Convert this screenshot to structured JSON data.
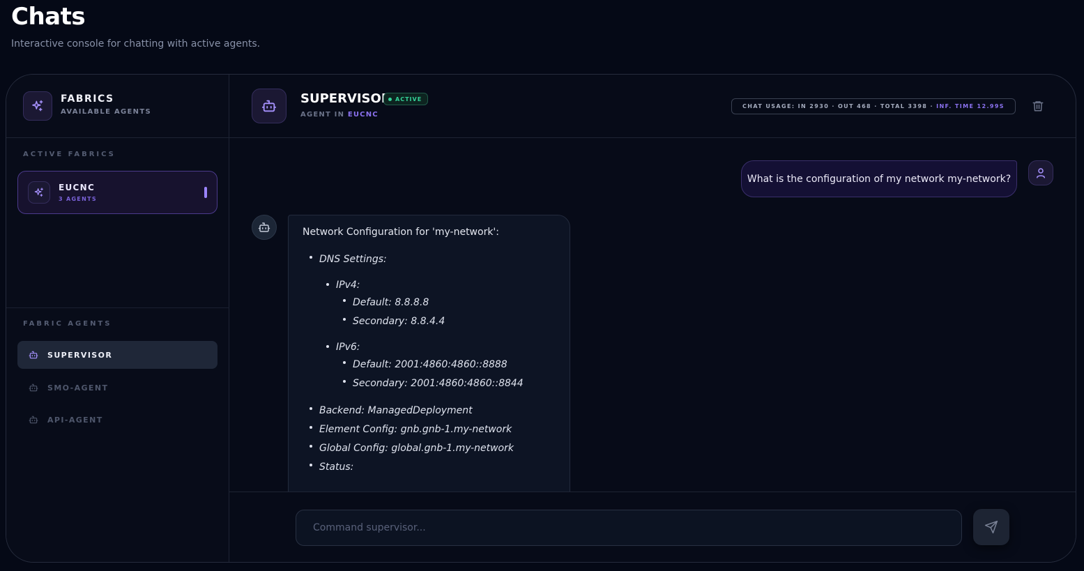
{
  "page": {
    "title": "Chats",
    "subtitle": "Interactive console for chatting with active agents."
  },
  "sidebar": {
    "title": "FABRICS",
    "subtitle": "AVAILABLE AGENTS",
    "active_fabrics_label": "ACTIVE FABRICS",
    "fabrics": [
      {
        "name": "EUCNC",
        "count": "3 AGENTS",
        "icon": "sparkles-icon"
      }
    ],
    "fabric_agents_label": "FABRIC AGENTS",
    "agents": [
      {
        "label": "SUPERVISOR",
        "icon": "bot-icon",
        "selected": true
      },
      {
        "label": "SMO-AGENT",
        "icon": "bot-icon",
        "selected": false
      },
      {
        "label": "API-AGENT",
        "icon": "bot-icon",
        "selected": false
      }
    ]
  },
  "chat": {
    "agent_name": "SUPERVISOR",
    "status": "ACTIVE",
    "agent_in_prefix": "AGENT IN",
    "fabric": "EUCNC",
    "usage_text": "CHAT USAGE: IN 2930 · OUT 468 · TOTAL 3398 ·",
    "inference_text": "INF. TIME 12.99S",
    "messages": {
      "user": "What is the configuration of my network my-network?",
      "bot_intro": "Network Configuration for 'my-network':",
      "dns_label": "DNS Settings:",
      "ipv4_label": "IPv4:",
      "ipv4_default": "Default: 8.8.8.8",
      "ipv4_secondary": "Secondary: 8.8.4.4",
      "ipv6_label": "IPv6:",
      "ipv6_default": "Default: 2001:4860:4860::8888",
      "ipv6_secondary": "Secondary: 2001:4860:4860::8844",
      "backend": "Backend: ManagedDeployment",
      "element_config": "Element Config: gnb.gnb-1.my-network",
      "global_config": "Global Config: global.gnb-1.my-network",
      "status": "Status:"
    },
    "input_placeholder": "Command supervisor..."
  },
  "colors": {
    "background": "#050916",
    "accent": "#8b72f0",
    "active_green": "#34d399"
  }
}
